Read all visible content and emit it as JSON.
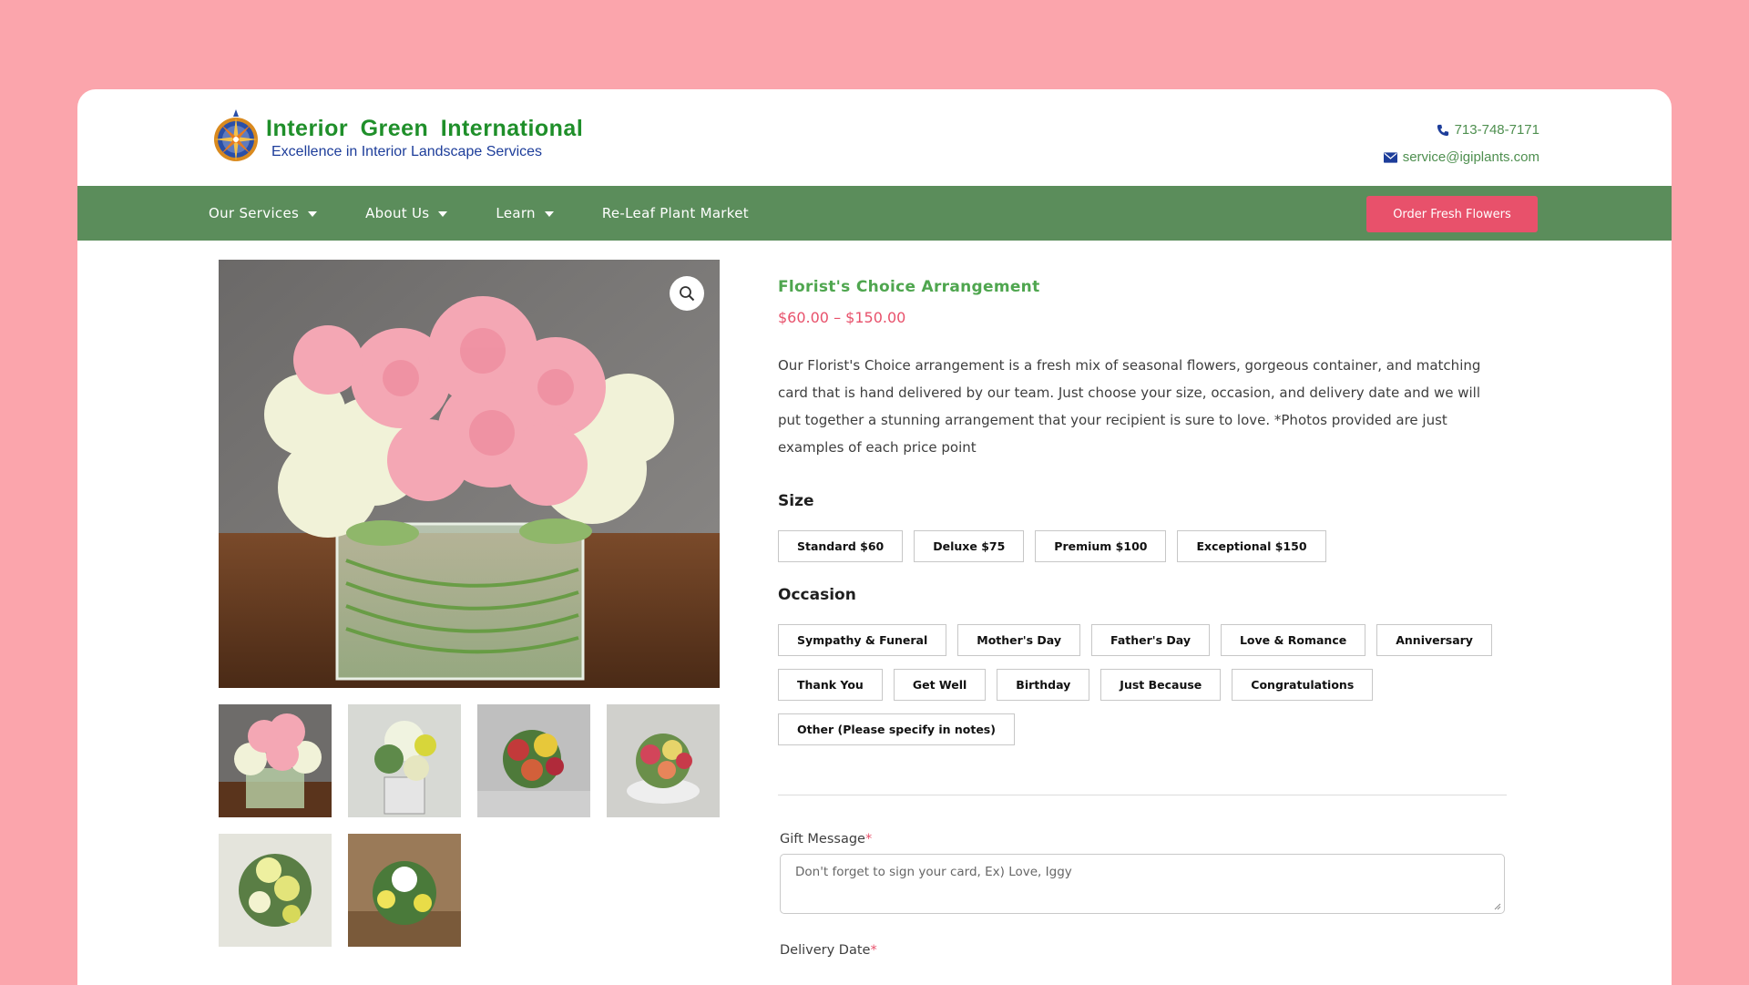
{
  "header": {
    "logo_title": "Interior Green International",
    "logo_subtitle": "Excellence in Interior Landscape Services",
    "phone": "713-748-7171",
    "email": "service@igiplants.com",
    "icons": {
      "phone": "phone-icon",
      "email": "envelope-icon"
    }
  },
  "nav": {
    "items": [
      {
        "label": "Our Services",
        "has_dropdown": true
      },
      {
        "label": "About Us",
        "has_dropdown": true
      },
      {
        "label": "Learn",
        "has_dropdown": true
      },
      {
        "label": "Re-Leaf Plant Market",
        "has_dropdown": false
      }
    ],
    "cta_label": "Order Fresh Flowers",
    "colors": {
      "bar": "#5b8d5b",
      "cta": "#e8516b"
    }
  },
  "gallery": {
    "zoom_icon": "magnifier-icon",
    "thumbnail_count": 6
  },
  "product": {
    "title": "Florist's Choice Arrangement",
    "price": "$60.00 – $150.00",
    "description": "Our Florist's Choice arrangement is a fresh mix of seasonal flowers, gorgeous container, and matching card that is hand delivered by our team. Just choose your size, occasion, and delivery date and we will put together a stunning arrangement that your recipient is sure to love. *Photos provided are just examples of each price point",
    "size_label": "Size",
    "sizes": [
      "Standard $60",
      "Deluxe $75",
      "Premium $100",
      "Exceptional $150"
    ],
    "occasion_label": "Occasion",
    "occasions": [
      "Sympathy & Funeral",
      "Mother's Day",
      "Father's Day",
      "Love & Romance",
      "Anniversary",
      "Thank You",
      "Get Well",
      "Birthday",
      "Just Because",
      "Congratulations",
      "Other (Please specify in notes)"
    ],
    "gift_message_label": "Gift Message",
    "gift_message_placeholder": "Don't forget to sign your card, Ex) Love, Iggy",
    "delivery_date_label": "Delivery Date",
    "required_mark": "*"
  },
  "colors": {
    "page_bg": "#fba5ac",
    "title_green": "#4fa64f",
    "price_pink": "#e8516b"
  }
}
